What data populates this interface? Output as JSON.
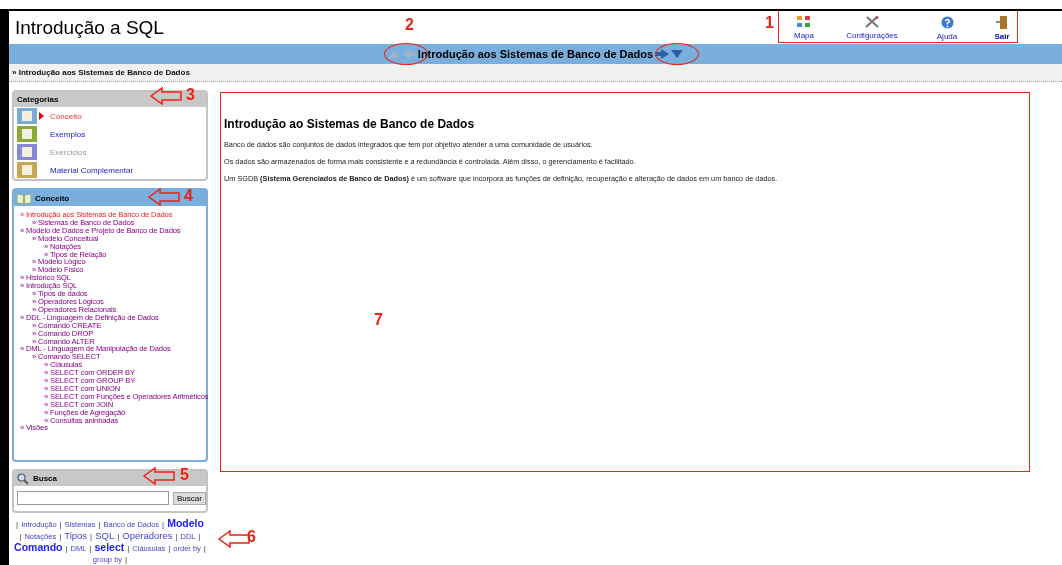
{
  "header": {
    "title": "Introdução a SQL",
    "links": [
      {
        "label": "Mapa",
        "bold": false
      },
      {
        "label": "Configurações",
        "bold": false
      },
      {
        "label": "Ajuda",
        "bold": false
      },
      {
        "label": "Sair",
        "bold": true
      }
    ]
  },
  "nav_bar": {
    "title": "Introdução aos Sistemas de Banco de Dados",
    "prev": {
      "disabled": true
    },
    "next": {
      "disabled": false
    }
  },
  "breadcrumb": "» Introdução aos Sistemas de Banco de Dados",
  "categories": {
    "title": "Categorias",
    "items": [
      {
        "label": "Conceito",
        "selected": true,
        "disabled": false
      },
      {
        "label": "Exemplos",
        "selected": false,
        "disabled": false
      },
      {
        "label": "Exercicios",
        "selected": false,
        "disabled": true
      },
      {
        "label": "Material Complementar",
        "selected": false,
        "disabled": false
      }
    ]
  },
  "concept_panel": {
    "title": "Conceito",
    "tree": [
      {
        "label": "» Introdução aos Sistemas de Banco de Dados",
        "selected": true,
        "children": [
          {
            "label": "» Sistemas de Banco de Dados",
            "selected": false
          }
        ]
      },
      {
        "label": "» Modelo de Dados e Projeto de Banco de Dados",
        "selected": false,
        "children": [
          {
            "label": "» Modelo Conceitual",
            "selected": false,
            "children": [
              {
                "label": "» Notações",
                "selected": false
              },
              {
                "label": "» Tipos de Relação",
                "selected": false
              }
            ]
          },
          {
            "label": "» Modelo Lógico",
            "selected": false
          },
          {
            "label": "» Modelo Físico",
            "selected": false
          }
        ]
      },
      {
        "label": "» Histórico SQL",
        "selected": false
      },
      {
        "label": "» Introdução SQL",
        "selected": false,
        "children": [
          {
            "label": "» Tipos de dados",
            "selected": false
          },
          {
            "label": "» Operadores Lógicos",
            "selected": false
          },
          {
            "label": "» Operadores Relacionais",
            "selected": false
          }
        ]
      },
      {
        "label": "» DDL - Linguagem de Definição de Dados",
        "selected": false,
        "children": [
          {
            "label": "» Comando CREATE",
            "selected": false
          },
          {
            "label": "» Comando DROP",
            "selected": false
          },
          {
            "label": "» Comando ALTER",
            "selected": false
          }
        ]
      },
      {
        "label": "» DML - Linguagem de Manipulação de Dados",
        "selected": false,
        "children": [
          {
            "label": "» Comando SELECT",
            "selected": false,
            "children": [
              {
                "label": "» Cláusulas",
                "selected": false
              },
              {
                "label": "» SELECT com ORDER BY",
                "selected": false
              },
              {
                "label": "» SELECT com GROUP BY",
                "selected": false
              },
              {
                "label": "» SELECT com UNION",
                "selected": false
              },
              {
                "label": "» SELECT com Funções e Operadores Aritméticos",
                "selected": false
              },
              {
                "label": "» SELECT com JOIN",
                "selected": false
              },
              {
                "label": "» Funções de Agregação",
                "selected": false
              },
              {
                "label": "» Consultas aninhadas",
                "selected": false
              }
            ]
          }
        ]
      },
      {
        "label": "» Visões",
        "selected": false
      }
    ]
  },
  "search": {
    "title": "Busca",
    "button": "Buscar"
  },
  "tag_cloud": [
    {
      "label": "|",
      "kind": "separator"
    },
    {
      "label": "Introdução",
      "kind": "small"
    },
    {
      "label": "|",
      "kind": "separator"
    },
    {
      "label": "Sistemas",
      "kind": "small"
    },
    {
      "label": "|",
      "kind": "separator"
    },
    {
      "label": "Banco de Dados",
      "kind": "small"
    },
    {
      "label": "|",
      "kind": "separator"
    },
    {
      "label": "Modelo",
      "kind": "large"
    },
    {
      "label": "|",
      "kind": "separator"
    },
    {
      "label": "Notações",
      "kind": "small"
    },
    {
      "label": "|",
      "kind": "separator"
    },
    {
      "label": "Tipos",
      "kind": "medium"
    },
    {
      "label": "|",
      "kind": "separator"
    },
    {
      "label": "SQL",
      "kind": "medium"
    },
    {
      "label": "|",
      "kind": "separator"
    },
    {
      "label": "Operadores",
      "kind": "medium"
    },
    {
      "label": "|",
      "kind": "separator"
    },
    {
      "label": "DDL",
      "kind": "small"
    },
    {
      "label": "|",
      "kind": "separator"
    },
    {
      "label": "Comando",
      "kind": "large"
    },
    {
      "label": "|",
      "kind": "separator"
    },
    {
      "label": "DML",
      "kind": "small"
    },
    {
      "label": "|",
      "kind": "separator"
    },
    {
      "label": "select",
      "kind": "large"
    },
    {
      "label": "|",
      "kind": "separator"
    },
    {
      "label": "Cláusulas",
      "kind": "small"
    },
    {
      "label": "|",
      "kind": "separator"
    },
    {
      "label": "order by",
      "kind": "small"
    },
    {
      "label": "|",
      "kind": "separator"
    },
    {
      "label": "group by",
      "kind": "small"
    },
    {
      "label": "|",
      "kind": "separator"
    }
  ],
  "article": {
    "title": "Introdução ao Sistemas de Banco de Dados",
    "paragraphs": [
      "Banco de dados são conjuntos de dados integrados que tem por objetivo atender a uma comunidade de usuários.",
      "Os dados são armazenados de forma mais consistente e a redundância é controlada. Além disso, o gerenciamento é facilitado.",
      "Um SGDB **(Sistema Gerenciados de Banco de Dados)** é um software que incorpora as funções de definição, recuperação e alteração de dados em um banco de dados."
    ]
  },
  "annotations": [
    {
      "kind": "box",
      "label": "1"
    },
    {
      "kind": "ellipses",
      "label": "2"
    },
    {
      "kind": "arrow",
      "label": "3"
    },
    {
      "kind": "arrow",
      "label": "4"
    },
    {
      "kind": "arrow",
      "label": "5"
    },
    {
      "kind": "arrow",
      "label": "6"
    },
    {
      "kind": "box",
      "label": "7"
    }
  ]
}
